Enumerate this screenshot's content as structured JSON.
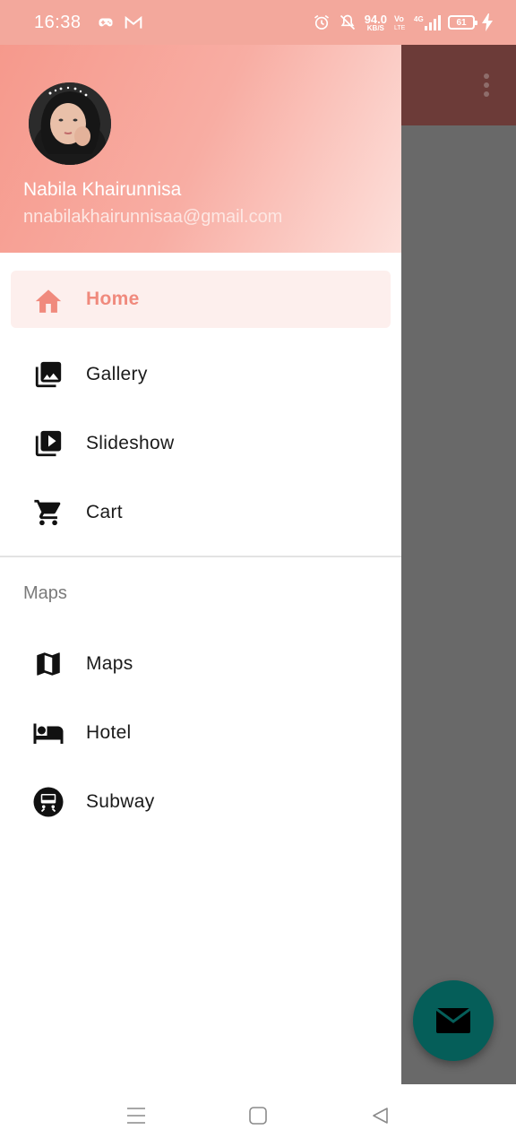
{
  "status_bar": {
    "time": "16:38",
    "net_speed": "94.0",
    "net_speed_unit": "KB/S",
    "battery": "61",
    "icons": [
      "game-icon",
      "gmail-icon",
      "alarm-icon",
      "mute-icon",
      "volte-icon",
      "signal-4g-icon",
      "battery-icon",
      "charging-icon"
    ]
  },
  "drawer": {
    "header": {
      "name": "Nabila Khairunnisa",
      "email": "nnabilakhairunnisaa@gmail.com"
    },
    "items": [
      {
        "label": "Home",
        "icon": "home-icon",
        "active": true
      },
      {
        "label": "Gallery",
        "icon": "gallery-icon"
      },
      {
        "label": "Slideshow",
        "icon": "slideshow-icon"
      },
      {
        "label": "Cart",
        "icon": "cart-icon"
      }
    ],
    "section_title": "Maps",
    "section_items": [
      {
        "label": "Maps",
        "icon": "map-icon"
      },
      {
        "label": "Hotel",
        "icon": "hotel-icon"
      },
      {
        "label": "Subway",
        "icon": "subway-icon"
      }
    ]
  },
  "app": {
    "overflow_icon": "more-vert-icon",
    "fab_icon": "mail-icon"
  },
  "colors": {
    "accent": "#f08a7d",
    "status_bar": "#f3a89c",
    "fab": "#055e59",
    "toolbar_scrim": "#6c3b38"
  }
}
